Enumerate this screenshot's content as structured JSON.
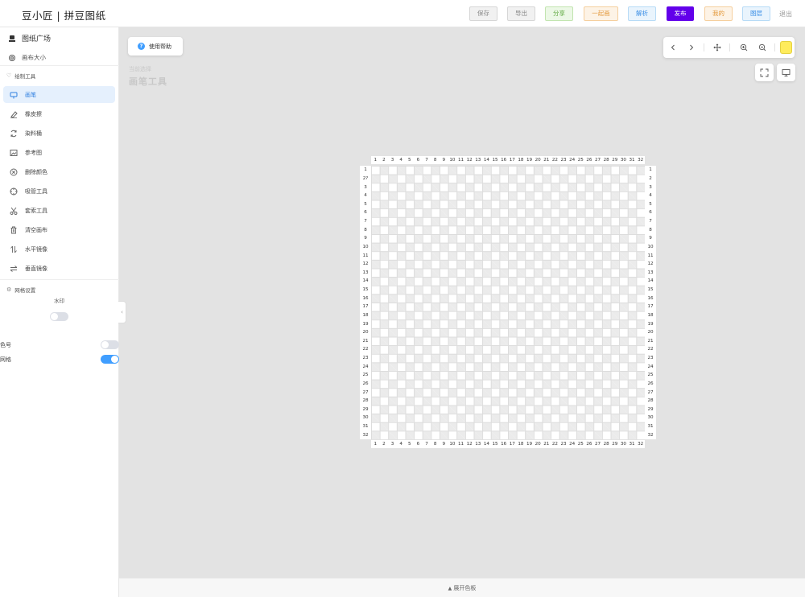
{
  "header": {
    "app_title": "豆小匠 | 拼豆图纸",
    "buttons": {
      "save": "保存",
      "export": "导出",
      "share": "分享",
      "together": "一起画",
      "parse": "解析",
      "publish": "发布",
      "mine": "我的",
      "layers": "图层",
      "logout": "退出"
    },
    "colors": {
      "publish": "#6200ea",
      "share": "#5ba73c",
      "together": "#e49a3d",
      "parse": "#3a8ee6"
    }
  },
  "sidebar": {
    "gallery": {
      "label": "图纸广场",
      "icon": "stamp-icon"
    },
    "canvas_size": {
      "label": "画布大小",
      "icon": "gear-icon"
    },
    "draw_tools_title": "绘制工具",
    "tools": [
      {
        "label": "画笔",
        "icon": "brush-icon",
        "active": true
      },
      {
        "label": "橡皮擦",
        "icon": "eraser-icon",
        "active": false
      },
      {
        "label": "染料桶",
        "icon": "bucket-icon",
        "active": false
      },
      {
        "label": "参考图",
        "icon": "image-icon",
        "active": false
      },
      {
        "label": "删除颜色",
        "icon": "delete-color-icon",
        "active": false
      },
      {
        "label": "吸管工具",
        "icon": "eyedropper-icon",
        "active": false
      },
      {
        "label": "套索工具",
        "icon": "scissors-icon",
        "active": false
      },
      {
        "label": "清空画布",
        "icon": "trash-icon",
        "active": false
      },
      {
        "label": "水平镜像",
        "icon": "mirror-horizontal-icon",
        "active": false
      },
      {
        "label": "垂直镜像",
        "icon": "mirror-vertical-icon",
        "active": false
      }
    ],
    "grid_settings_title": "网格设置",
    "watermark_label": "水印",
    "watermark_on": false,
    "color_code_label": "色号",
    "color_code_on": false,
    "grid_label": "网格",
    "grid_on": true
  },
  "main": {
    "help_button": "使用帮助",
    "current_tool_caption": "当前选择",
    "current_tool_name": "画笔工具",
    "toolbar_icons": [
      "undo-icon",
      "redo-icon",
      "move-icon",
      "zoom-in-icon",
      "zoom-out-icon"
    ],
    "current_color": "#ffec5c",
    "expand_palette": "展开色板"
  },
  "grid": {
    "columns": 32,
    "rows": 32,
    "left_row_labels": [
      "1",
      "2?",
      "3",
      "4",
      "5",
      "6",
      "7",
      "8",
      "9",
      "10",
      "11",
      "12",
      "13",
      "14",
      "15",
      "16",
      "17",
      "18",
      "19",
      "20",
      "21",
      "22",
      "23",
      "24",
      "25",
      "26",
      "27",
      "28",
      "29",
      "30",
      "31",
      "32"
    ]
  }
}
